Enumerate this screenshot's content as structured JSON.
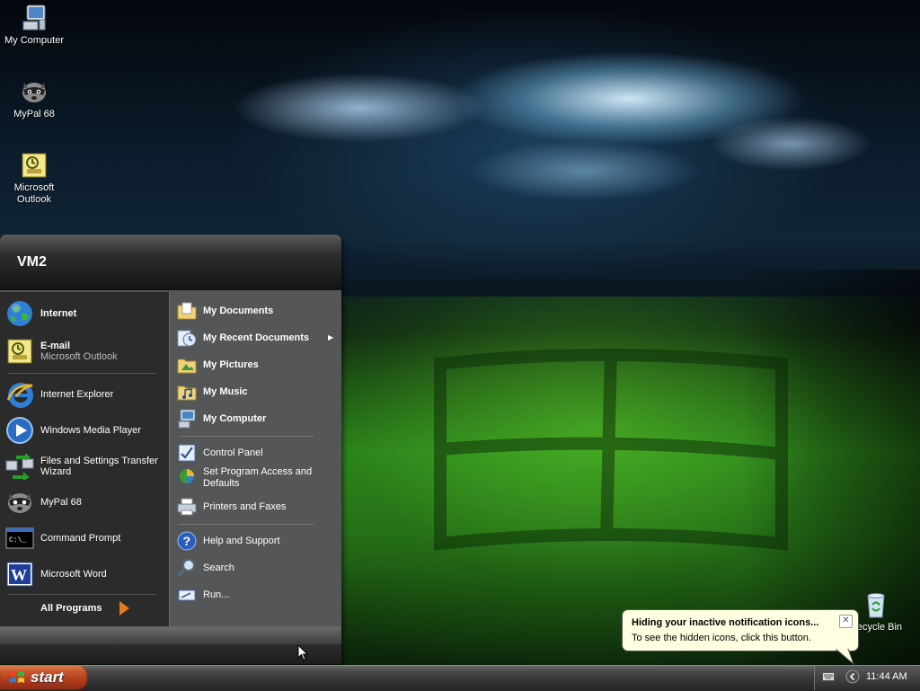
{
  "desktop": {
    "icons": [
      {
        "label": "My Computer",
        "icon": "my-computer-icon"
      },
      {
        "label": "MyPal 68",
        "icon": "mypal-icon"
      },
      {
        "label": "Microsoft Outlook",
        "icon": "outlook-icon"
      },
      {
        "label": "Recycle Bin",
        "icon": "recycle-bin-icon"
      }
    ]
  },
  "start_menu": {
    "user": "VM2",
    "pinned": [
      {
        "label": "Internet",
        "icon": "globe-icon"
      },
      {
        "label": "E-mail",
        "sublabel": "Microsoft Outlook",
        "icon": "outlook-icon"
      }
    ],
    "recent": [
      {
        "label": "Internet Explorer",
        "icon": "internet-explorer-icon"
      },
      {
        "label": "Windows Media Player",
        "icon": "media-player-icon"
      },
      {
        "label": "Files and Settings Transfer Wizard",
        "icon": "transfer-wizard-icon"
      },
      {
        "label": "MyPal 68",
        "icon": "mypal-icon"
      },
      {
        "label": "Command Prompt",
        "icon": "command-prompt-icon"
      },
      {
        "label": "Microsoft Word",
        "icon": "word-icon"
      }
    ],
    "all_programs": "All Programs",
    "places": [
      {
        "label": "My Documents",
        "icon": "folder-documents-icon"
      },
      {
        "label": "My Recent Documents",
        "icon": "recent-documents-icon"
      },
      {
        "label": "My Pictures",
        "icon": "folder-pictures-icon"
      },
      {
        "label": "My Music",
        "icon": "folder-music-icon"
      },
      {
        "label": "My Computer",
        "icon": "my-computer-icon"
      }
    ],
    "settings": [
      {
        "label": "Control Panel",
        "icon": "control-panel-icon"
      },
      {
        "label": "Set Program Access and Defaults",
        "icon": "program-defaults-icon"
      },
      {
        "label": "Printers and Faxes",
        "icon": "printer-icon"
      }
    ],
    "tools": [
      {
        "label": "Help and Support",
        "icon": "help-icon"
      },
      {
        "label": "Search",
        "icon": "search-icon"
      },
      {
        "label": "Run...",
        "icon": "run-icon"
      }
    ]
  },
  "taskbar": {
    "start_label": "start",
    "clock": "11:44 AM"
  },
  "balloon": {
    "title": "Hiding your inactive notification icons...",
    "text": "To see the hidden icons, click this button."
  },
  "colors": {
    "start_button": "#c9562a",
    "menu_left_bg": "#2b2b2b",
    "menu_right_bg": "#555657",
    "balloon_bg": "#ffffe1"
  }
}
